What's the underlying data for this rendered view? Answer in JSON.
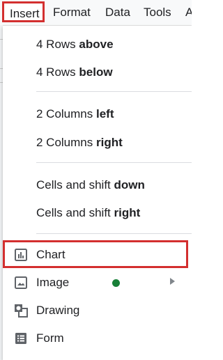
{
  "menubar": {
    "items": [
      {
        "label": "Insert",
        "active": true
      },
      {
        "label": "Format"
      },
      {
        "label": "Data"
      },
      {
        "label": "Tools"
      },
      {
        "label": "A"
      }
    ]
  },
  "menu": {
    "rows_above": {
      "prefix": "4 Rows ",
      "bold": "above"
    },
    "rows_below": {
      "prefix": "4 Rows ",
      "bold": "below"
    },
    "columns_left": {
      "prefix": "2 Columns ",
      "bold": "left"
    },
    "columns_right": {
      "prefix": "2 Columns ",
      "bold": "right"
    },
    "cells_down": {
      "prefix": "Cells and shift ",
      "bold": "down"
    },
    "cells_right": {
      "prefix": "Cells and shift ",
      "bold": "right"
    },
    "chart": {
      "label": "Chart",
      "icon": "chart-icon",
      "highlighted": true
    },
    "image": {
      "label": "Image",
      "icon": "image-icon",
      "has_submenu": true,
      "status_color": "#188038"
    },
    "drawing": {
      "label": "Drawing",
      "icon": "drawing-icon"
    },
    "form": {
      "label": "Form",
      "icon": "form-icon"
    }
  },
  "colors": {
    "highlight": "#d32f2f",
    "status_dot": "#188038",
    "text": "#202124"
  }
}
